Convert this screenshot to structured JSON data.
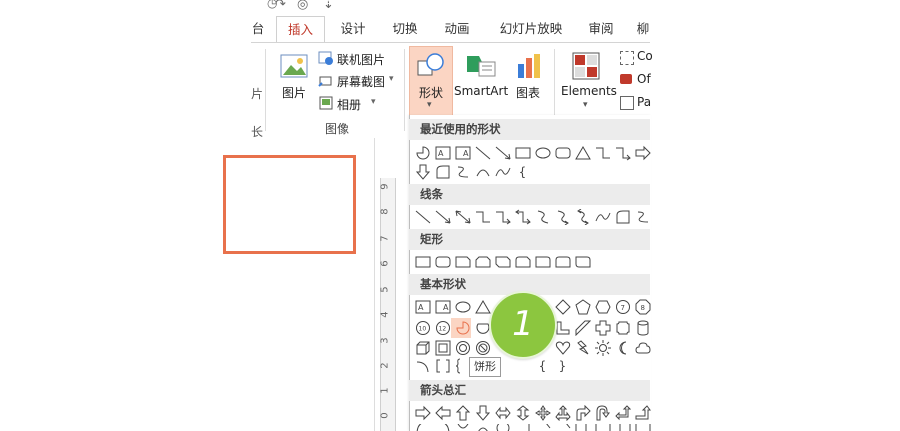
{
  "quick_access": {
    "undo_symbol": "↶",
    "redo_symbol": "↷",
    "clock_symbol": "◷",
    "view_symbol": "◎",
    "dropdown_symbol": "⇣"
  },
  "tabs": [
    {
      "label": "台",
      "active": false
    },
    {
      "label": "插入",
      "active": true
    },
    {
      "label": "设计",
      "active": false
    },
    {
      "label": "切换",
      "active": false
    },
    {
      "label": "动画",
      "active": false
    },
    {
      "label": "幻灯片放映",
      "active": false
    },
    {
      "label": "审阅",
      "active": false
    },
    {
      "label": "柳",
      "active": false
    }
  ],
  "ribbon": {
    "images_group": {
      "picture": "图片",
      "online_picture": "联机图片",
      "screenshot": "屏幕截图",
      "album": "相册",
      "group_label": "图像"
    },
    "shapes": {
      "label": "形状",
      "arrow": "▾"
    },
    "smartart": {
      "label": "SmartArt"
    },
    "chart": {
      "label": "图表"
    },
    "elements": {
      "label": "Elements",
      "arrow": "▾"
    },
    "cutoff": [
      "Co",
      "Of",
      "Pa"
    ],
    "left_fragments": [
      "台",
      "片",
      "长"
    ]
  },
  "shapes_dropdown": {
    "sections": {
      "recent": "最近使用的形状",
      "lines": "线条",
      "rectangles": "矩形",
      "basic": "基本形状",
      "arrows": "箭头总汇"
    },
    "tooltip": "饼形",
    "step_badge": "1",
    "brace_text": {
      "open": "{",
      "close": "}"
    }
  },
  "ruler": {
    "numbers": [
      "9",
      "8",
      "7",
      "6",
      "5",
      "4",
      "3",
      "2",
      "1",
      "0"
    ]
  },
  "colors": {
    "accent": "#c0392b",
    "slide_border": "#e8714c",
    "badge": "#8cc63f",
    "highlight": "#fbd5c3"
  }
}
